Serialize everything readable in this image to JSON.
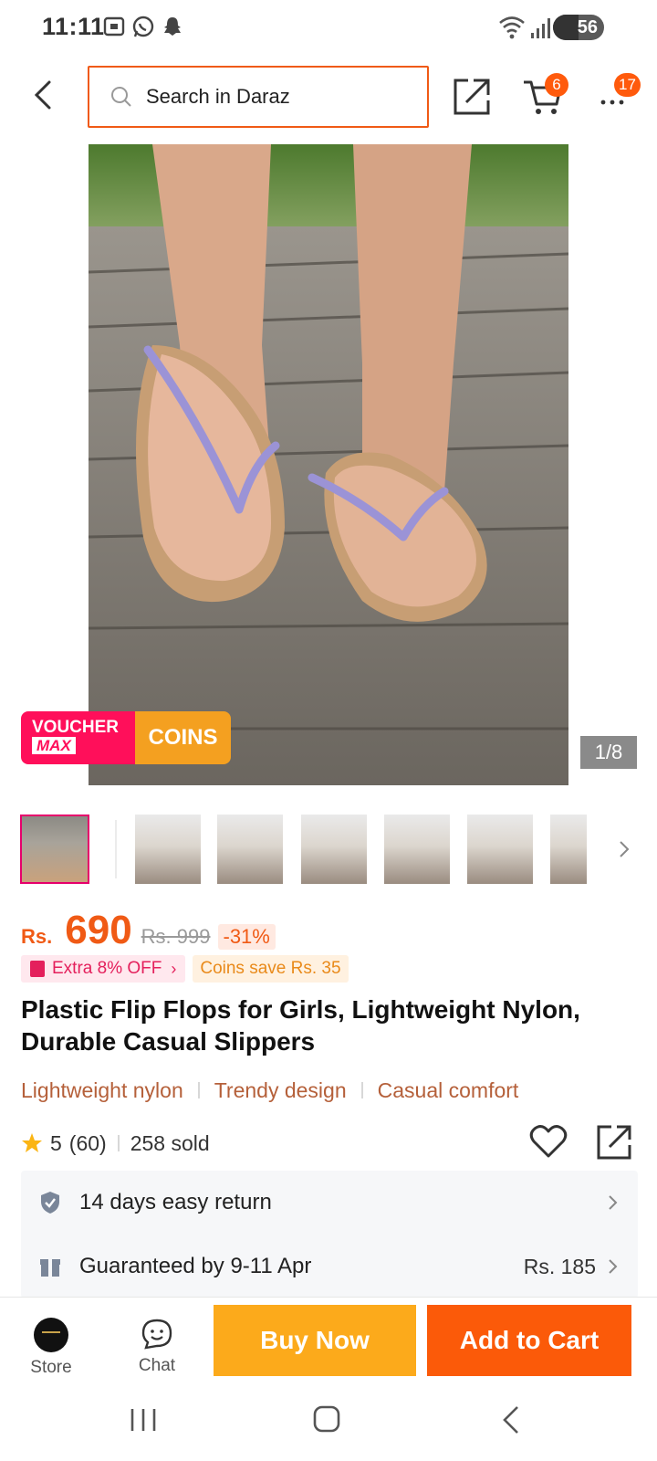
{
  "status_bar": {
    "time": "11:11",
    "battery": "56",
    "icons": [
      "screenshot-icon",
      "whatsapp-icon",
      "snapchat-icon",
      "wifi-icon",
      "signal-icon"
    ]
  },
  "header": {
    "search_placeholder": "Search in Daraz",
    "cart_count": "6",
    "more_count": "17"
  },
  "gallery": {
    "counter": "1/8",
    "voucher_line1": "VOUCHER",
    "voucher_line2": "MAX",
    "coins_label": "COINS"
  },
  "price": {
    "currency": "Rs.",
    "current": "690",
    "original": "Rs. 999",
    "discount": "-31%"
  },
  "promos": {
    "extra_off": "Extra 8% OFF",
    "coins_save": "Coins save Rs. 35"
  },
  "product": {
    "title": "Plastic Flip Flops for Girls, Lightweight Nylon, Durable Casual Slippers",
    "tags": [
      "Lightweight nylon",
      "Trendy design",
      "Casual comfort"
    ],
    "rating": "5",
    "reviews": "(60)",
    "sold": "258 sold"
  },
  "service": {
    "return": "14 days easy return",
    "delivery": "Guaranteed by 9-11 Apr",
    "delivery_fee": "Rs. 185"
  },
  "bottom_bar": {
    "store_label": "Store",
    "chat_label": "Chat",
    "buy_now": "Buy Now",
    "add_to_cart": "Add to Cart"
  },
  "colors": {
    "accent": "#f05a15",
    "buy_now": "#fcaa1b",
    "add_to_cart": "#fb5a09",
    "voucher": "#ff0f5a",
    "coins": "#f4a020"
  }
}
